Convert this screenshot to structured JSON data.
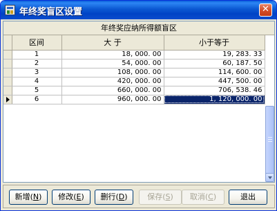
{
  "window": {
    "title": "年终奖盲区设置"
  },
  "grid": {
    "group_header": "年终奖应纳所得额盲区",
    "columns": [
      "区间",
      "大 于",
      "小于等于"
    ],
    "rows": [
      {
        "interval": "1",
        "gt": "18, 000. 00",
        "lte": "19, 283. 33"
      },
      {
        "interval": "2",
        "gt": "54, 000. 00",
        "lte": "60, 187. 50"
      },
      {
        "interval": "3",
        "gt": "108, 000. 00",
        "lte": "114, 600. 00"
      },
      {
        "interval": "4",
        "gt": "420, 000. 00",
        "lte": "447, 500. 00"
      },
      {
        "interval": "5",
        "gt": "660, 000. 00",
        "lte": "706, 538. 46"
      },
      {
        "interval": "6",
        "gt": "960, 000. 00",
        "lte": "1, 120, 000. 00"
      }
    ],
    "current_row": 6
  },
  "buttons": {
    "add": {
      "label": "新增",
      "hotkey": "N"
    },
    "edit": {
      "label": "修改",
      "hotkey": "E"
    },
    "delete": {
      "label": "删行",
      "hotkey": "D"
    },
    "save": {
      "label": "保存",
      "hotkey": "S"
    },
    "cancel": {
      "label": "取消",
      "hotkey": "C"
    },
    "exit": {
      "label": "退出"
    }
  },
  "colors": {
    "titlebar": "#0054e3",
    "selection": "#0a246a",
    "face": "#ece9d8"
  }
}
